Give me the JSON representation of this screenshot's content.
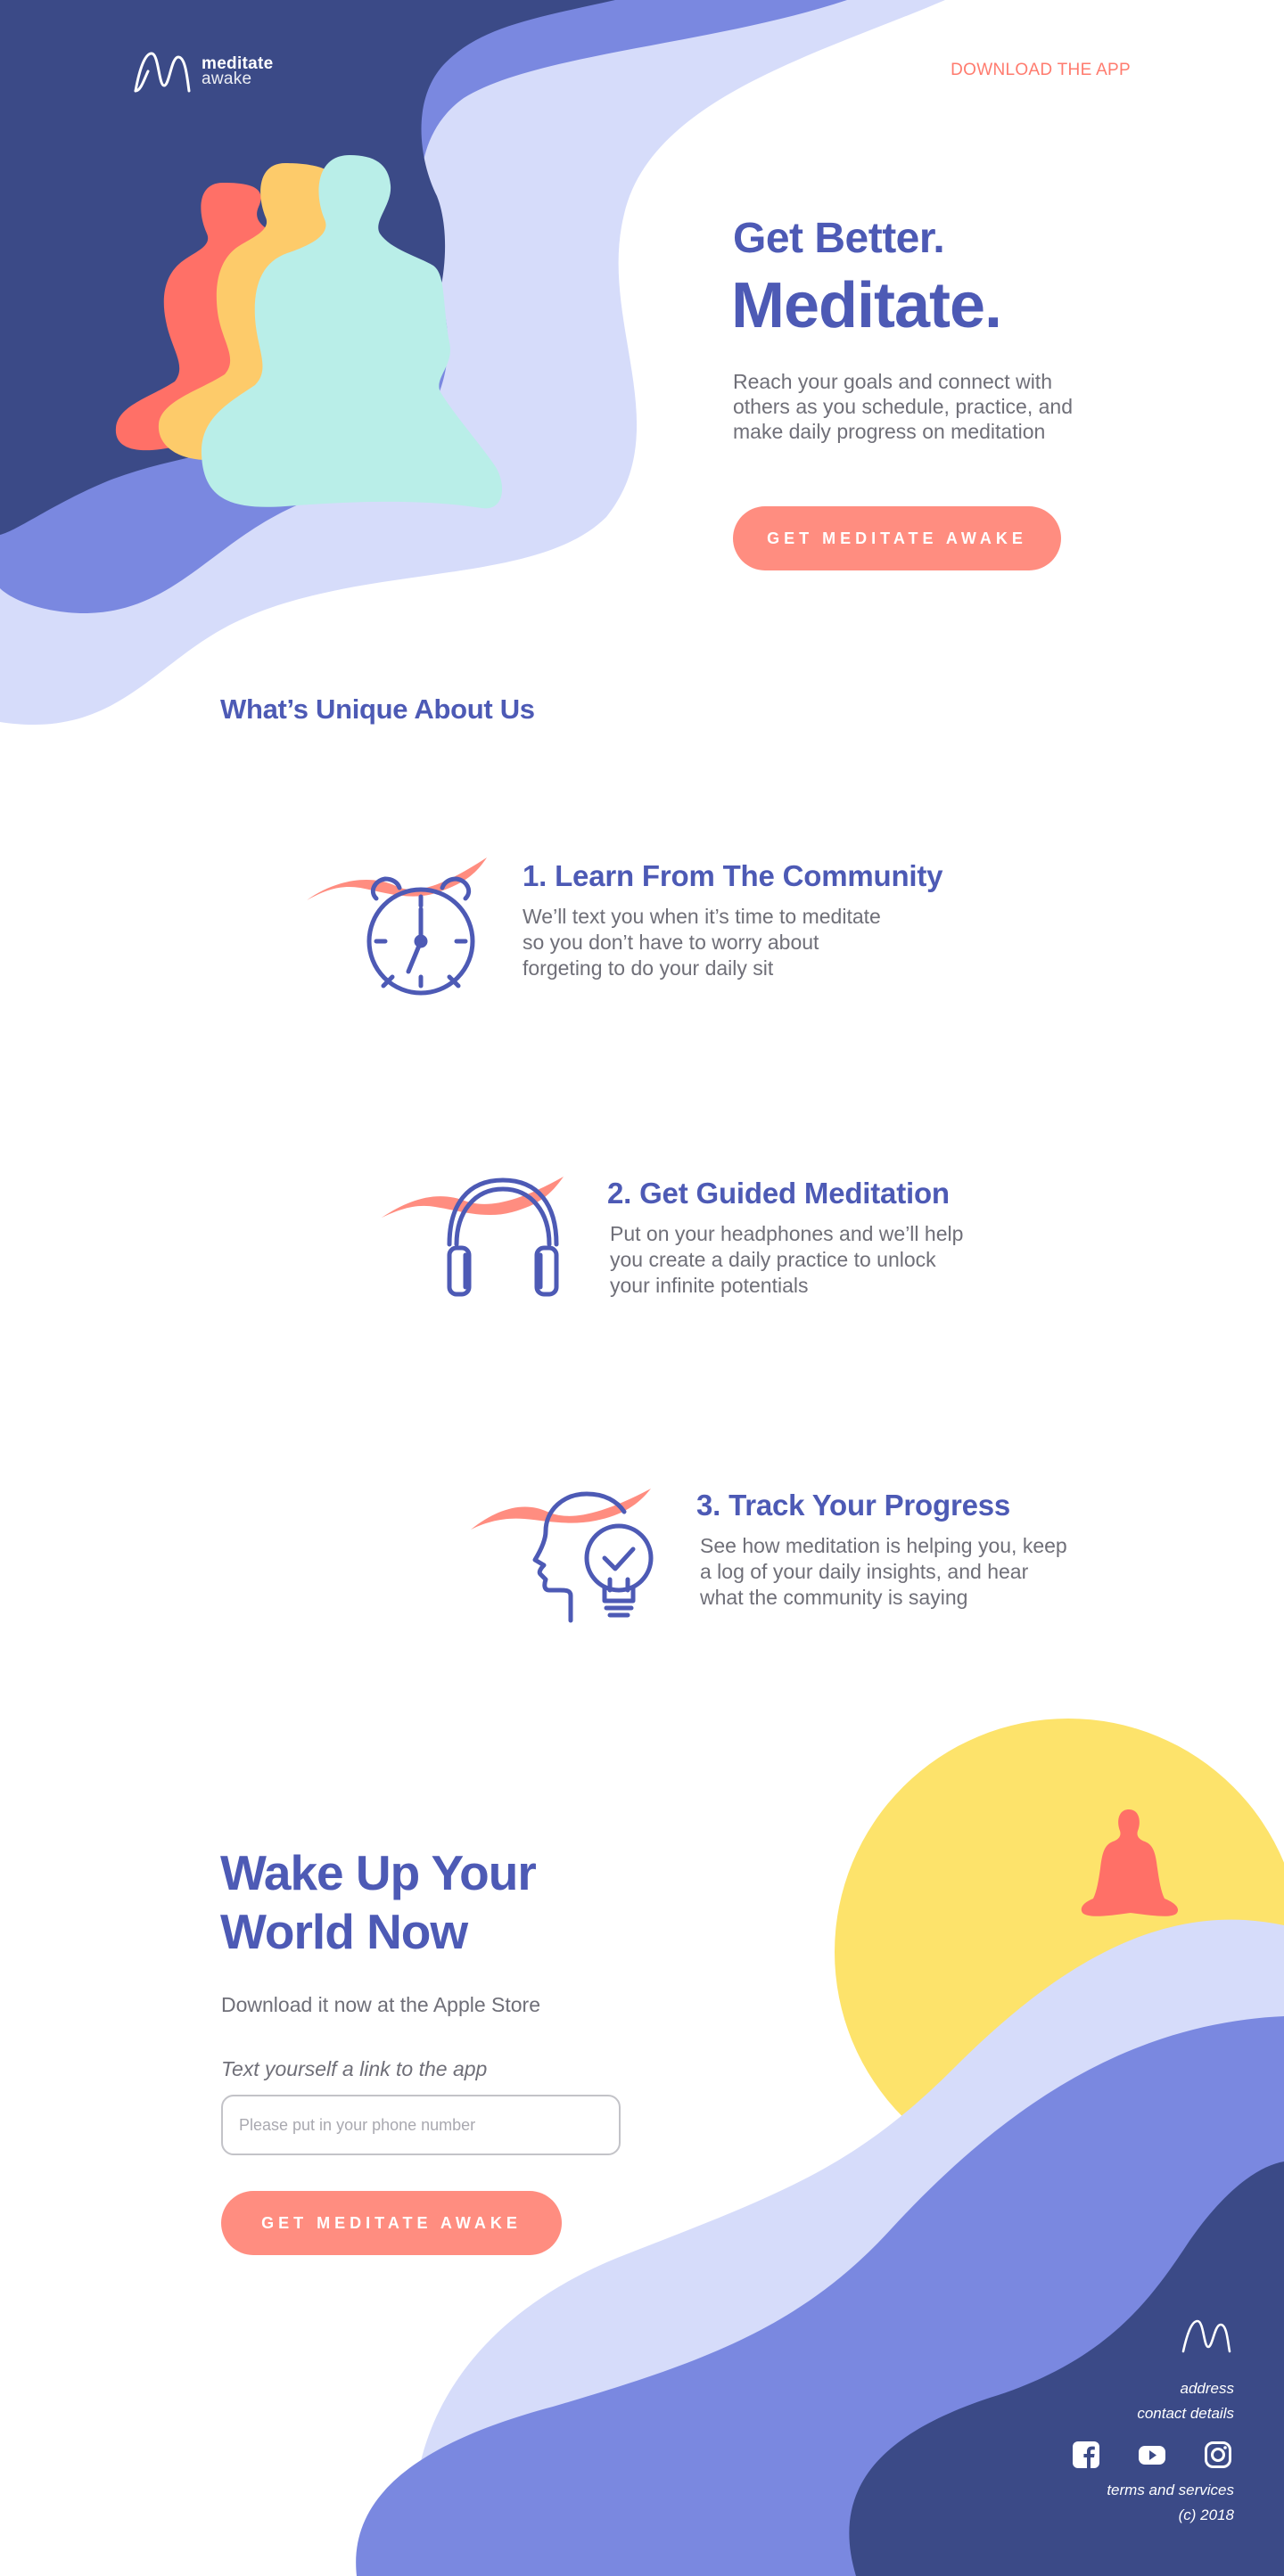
{
  "header": {
    "logo_line1": "meditate",
    "logo_line2": "awake",
    "download_link": "DOWNLOAD THE APP"
  },
  "hero": {
    "title_line1": "Get Better.",
    "title_line2": "Meditate.",
    "description": "Reach your goals and connect with others as you schedule, practice, and make daily progress on meditation",
    "cta_label": "GET MEDITATE AWAKE"
  },
  "unique": {
    "title": "What’s Unique About Us"
  },
  "features": [
    {
      "title": "1. Learn From The Community",
      "description": "We’ll text you when it’s time to meditate so you don’t have to worry about forgeting to do your daily sit",
      "icon": "alarm-clock-icon"
    },
    {
      "title": "2. Get Guided Meditation",
      "description": "Put on your headphones and we’ll help you create a daily practice to unlock your infinite potentials",
      "icon": "headphones-icon"
    },
    {
      "title": "3. Track Your Progress",
      "description": "See how meditation is helping you, keep a log of your daily insights, and hear what the community is saying",
      "icon": "head-lightbulb-icon"
    }
  ],
  "wake": {
    "title": "Wake Up Your World Now",
    "subtitle": "Download it now at the Apple Store",
    "input_label": "Text yourself a link to the app",
    "input_placeholder": "Please put in your phone number",
    "input_value": "",
    "cta_label": "GET MEDITATE AWAKE"
  },
  "footer": {
    "address": "address",
    "contact": "contact details",
    "social": [
      "facebook-icon",
      "youtube-icon",
      "instagram-icon"
    ],
    "terms": "terms and services",
    "copyright": "(c) 2018"
  },
  "colors": {
    "primary": "#4d5ab5",
    "accent": "#ff8d80",
    "navy": "#3b4a87",
    "periwinkle": "#7a88e0",
    "lavender": "#d6dcfa",
    "sun": "#fde36b",
    "text_gray": "#6f6f78"
  }
}
